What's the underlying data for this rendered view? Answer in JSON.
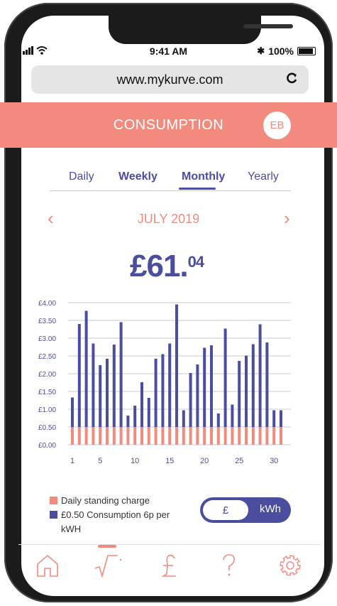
{
  "status": {
    "time": "9:41 AM",
    "battery": "100%"
  },
  "browser": {
    "url": "www.mykurve.com"
  },
  "header": {
    "title": "CONSUMPTION",
    "avatar": "EB"
  },
  "tabs": [
    {
      "label": "Daily",
      "bold": false
    },
    {
      "label": "Weekly",
      "bold": true
    },
    {
      "label": "Monthly",
      "bold": true,
      "selected": true
    },
    {
      "label": "Yearly",
      "bold": false
    }
  ],
  "period": {
    "label": "JULY 2019"
  },
  "total": {
    "main": "£61.",
    "fraction": "04"
  },
  "chart_data": {
    "type": "bar",
    "stacked": true,
    "x": [
      1,
      2,
      3,
      4,
      5,
      6,
      7,
      8,
      9,
      10,
      11,
      12,
      13,
      14,
      15,
      16,
      17,
      18,
      19,
      20,
      21,
      22,
      23,
      24,
      25,
      26,
      27,
      28,
      29,
      30,
      31
    ],
    "x_ticks": [
      "1",
      "5",
      "10",
      "15",
      "20",
      "25",
      "30"
    ],
    "y_ticks": [
      "£0.00",
      "£0.50",
      "£1.00",
      "£1.50",
      "£2.00",
      "£2.50",
      "£3.00",
      "£3.50",
      "£4.00"
    ],
    "ylim": [
      0,
      4
    ],
    "series": [
      {
        "name": "Daily standing charge",
        "color": "#f28b7e",
        "values": [
          0.5,
          0.5,
          0.5,
          0.5,
          0.5,
          0.5,
          0.5,
          0.5,
          0.5,
          0.5,
          0.5,
          0.5,
          0.5,
          0.5,
          0.5,
          0.5,
          0.5,
          0.5,
          0.5,
          0.5,
          0.5,
          0.5,
          0.5,
          0.5,
          0.5,
          0.5,
          0.5,
          0.5,
          0.5,
          0.5,
          0.5
        ]
      },
      {
        "name": "£0.50 Consumption 6p per kWH",
        "color": "#4b4d9e",
        "values": [
          0.83,
          2.9,
          3.27,
          2.35,
          1.74,
          1.92,
          2.32,
          2.95,
          0.32,
          0.6,
          1.26,
          0.82,
          1.92,
          2.05,
          2.35,
          3.45,
          0.47,
          1.52,
          1.76,
          2.23,
          2.3,
          0.38,
          2.77,
          0.63,
          1.86,
          2.01,
          2.33,
          2.89,
          2.38,
          0.47,
          0.47
        ]
      }
    ],
    "totals": [
      1.33,
      3.4,
      3.77,
      2.85,
      2.24,
      2.42,
      2.82,
      3.45,
      0.82,
      1.1,
      1.76,
      1.32,
      2.42,
      2.55,
      2.85,
      3.95,
      0.97,
      2.02,
      2.26,
      2.73,
      2.8,
      0.88,
      3.27,
      1.13,
      2.36,
      2.51,
      2.83,
      3.39,
      2.88,
      0.97,
      0.97
    ]
  },
  "legend": {
    "standing": "Daily standing charge",
    "consumption_line1": "£0.50 Consumption 6p per",
    "consumption_line2": "kWH"
  },
  "units_toggle": {
    "left": "£",
    "right": "kWh",
    "selected": "£"
  },
  "nav": {
    "icons": [
      "home-icon",
      "consumption-icon",
      "pound-icon",
      "help-icon",
      "settings-icon"
    ],
    "active": "consumption-icon"
  },
  "colors": {
    "accent": "#f28b7e",
    "primary": "#4b4d9e"
  }
}
